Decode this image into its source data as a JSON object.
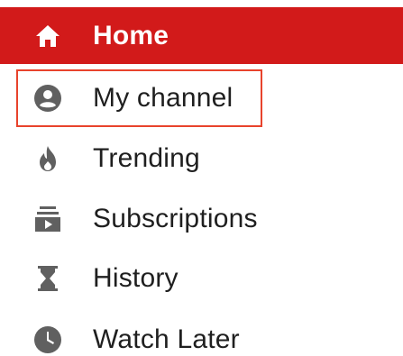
{
  "sidebar": {
    "accent_color": "#d21a1a",
    "highlight_color": "#e8432c",
    "items": [
      {
        "label": "Home",
        "icon": "home-icon",
        "active": true
      },
      {
        "label": "My channel",
        "icon": "account-icon",
        "highlighted": true
      },
      {
        "label": "Trending",
        "icon": "flame-icon"
      },
      {
        "label": "Subscriptions",
        "icon": "subscriptions-icon"
      },
      {
        "label": "History",
        "icon": "hourglass-icon"
      },
      {
        "label": "Watch Later",
        "icon": "clock-icon"
      }
    ]
  }
}
